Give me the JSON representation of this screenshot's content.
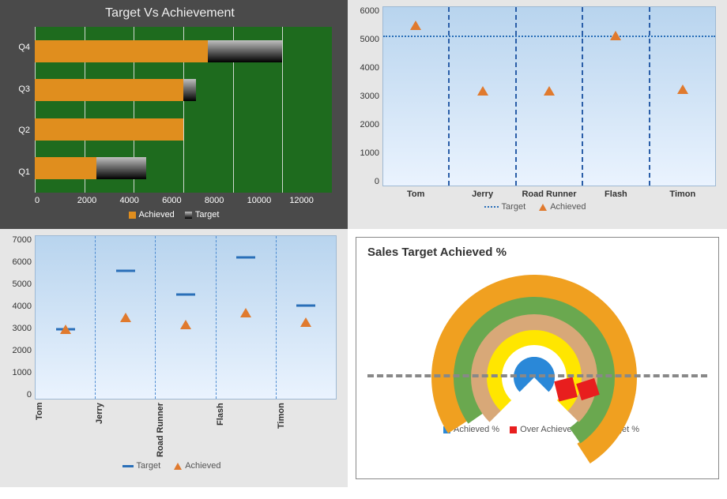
{
  "chart_data": [
    {
      "id": "c1",
      "type": "bar",
      "orientation": "horizontal",
      "title": "Target Vs Achievement",
      "xlim": [
        0,
        12000
      ],
      "xticks": [
        0,
        2000,
        4000,
        6000,
        8000,
        10000,
        12000
      ],
      "categories": [
        "Q1",
        "Q2",
        "Q3",
        "Q4"
      ],
      "series": [
        {
          "name": "Target",
          "values": [
            4500,
            5000,
            6500,
            10000
          ]
        },
        {
          "name": "Achieved",
          "values": [
            2500,
            6000,
            6000,
            7000
          ]
        }
      ],
      "legend": [
        "Achieved",
        "Target"
      ]
    },
    {
      "id": "c2",
      "type": "scatter",
      "title": "",
      "ylim": [
        0,
        6000
      ],
      "yticks": [
        0,
        1000,
        2000,
        3000,
        4000,
        5000,
        6000
      ],
      "target_line": 5000,
      "categories": [
        "Tom",
        "Jerry",
        "Road Runner",
        "Flash",
        "Timon"
      ],
      "series": [
        {
          "name": "Achieved",
          "marker": "triangle",
          "values": [
            5400,
            3200,
            3200,
            5050,
            3250
          ]
        }
      ],
      "legend": [
        "Target",
        "Achieved"
      ],
      "target_legend_style": "dotted"
    },
    {
      "id": "c3",
      "type": "scatter",
      "title": "",
      "ylim": [
        0,
        7000
      ],
      "yticks": [
        0,
        1000,
        2000,
        3000,
        4000,
        5000,
        6000,
        7000
      ],
      "categories": [
        "Tom",
        "Jerry",
        "Road Runner",
        "Flash",
        "Timon"
      ],
      "series": [
        {
          "name": "Target",
          "marker": "dash",
          "values": [
            3000,
            5500,
            4500,
            6100,
            4000
          ]
        },
        {
          "name": "Achieved",
          "marker": "triangle",
          "values": [
            3000,
            3500,
            3200,
            3700,
            3300
          ]
        }
      ],
      "legend": [
        "Target",
        "Achieved"
      ],
      "xaxis_orientation": "vertical"
    },
    {
      "id": "c4",
      "type": "pie",
      "title": "Sales Target Achieved %",
      "legend": [
        "Achieved %",
        "Over Achieved %",
        "Target %"
      ],
      "note": "semi-circular gauge with concentric bands; red wedges below baseline indicate over-achieved portion",
      "band_colors": [
        "#f0a020",
        "#6aa84f",
        "#d8a878",
        "#ffe600",
        "#ffffff",
        "#2a88d8"
      ]
    }
  ],
  "c1_ticks": {
    "t0": "0",
    "t1": "2000",
    "t2": "4000",
    "t3": "6000",
    "t4": "8000",
    "t5": "10000",
    "t6": "12000"
  },
  "c2_ticks": {
    "t0": "0",
    "t1": "1000",
    "t2": "2000",
    "t3": "3000",
    "t4": "4000",
    "t5": "5000",
    "t6": "6000"
  },
  "c3_ticks": {
    "t0": "0",
    "t1": "1000",
    "t2": "2000",
    "t3": "3000",
    "t4": "4000",
    "t5": "5000",
    "t6": "6000",
    "t7": "7000"
  },
  "names": {
    "tom": "Tom",
    "jerry": "Jerry",
    "rr": "Road Runner",
    "flash": "Flash",
    "timon": "Timon"
  },
  "q": {
    "q1": "Q1",
    "q2": "Q2",
    "q3": "Q3",
    "q4": "Q4"
  },
  "lg": {
    "target": "Target",
    "achieved": "Achieved",
    "ach_pct": "Achieved %",
    "over_pct": "Over Achieved %",
    "tgt_pct": "Target %"
  }
}
